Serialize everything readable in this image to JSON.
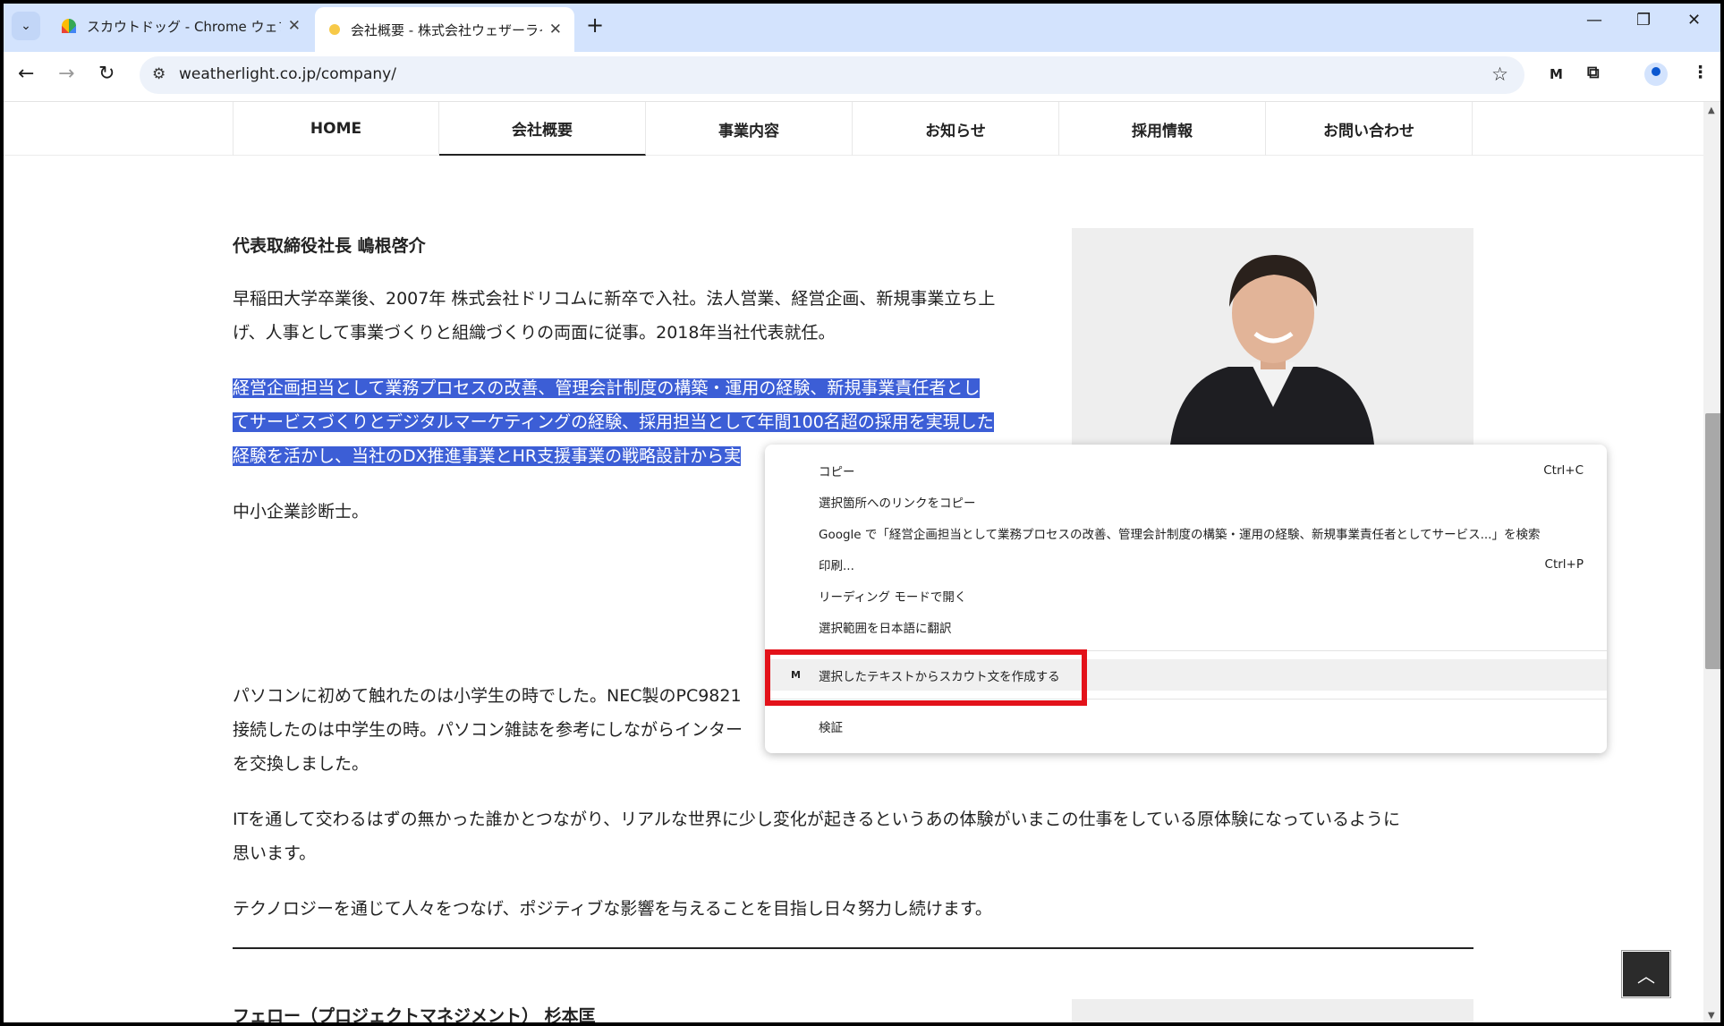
{
  "browser": {
    "tabs": [
      {
        "title": "スカウトドッグ - Chrome ウェブストア",
        "favicon": "rainbow-favicon"
      },
      {
        "title": "会社概要 - 株式会社ウェザーライト",
        "favicon": "sun-favicon"
      }
    ],
    "url": "weatherlight.co.jp/company/"
  },
  "site_nav": [
    "HOME",
    "会社概要",
    "事業内容",
    "お知らせ",
    "採用情報",
    "お問い合わせ"
  ],
  "profile": {
    "name": "代表取締役社長 嶋根啓介",
    "bio1_line1": "早稲田大学卒業後、2007年 株式会社ドリコムに新卒で入社。法人営業、経営企画、新規事業立ち上",
    "bio1_line2": "げ、人事として事業づくりと組織づくりの両面に従事。2018年当社代表就任。",
    "sel_line1": "経営企画担当として業務プロセスの改善、管理会計制度の構築・運用の経験、新規事業責任者とし",
    "sel_line2": "てサービスづくりとデジタルマーケティングの経験、採用担当として年間100名超の採用を実現した",
    "sel_line3": "経験を活かし、当社のDX推進事業とHR支援事業の戦略設計から実",
    "cert": "中小企業診断士。",
    "story_line1": "パソコンに初めて触れたのは小学生の時でした。NEC製のPC9821",
    "story_line2": "接続したのは中学生の時。パソコン雑誌を参考にしながらインター",
    "story_line3": "を交換しました。",
    "it_line1": "ITを通して交わるはずの無かった誰かとつながり、リアルな世界に少し変化が起きるというあの体験がいまこの仕事をしている原体験になっているように",
    "it_line2": "思います。",
    "closing": "テクノロジーを通じて人々をつなげ、ポジティブな影響を与えることを目指し日々努力し続けます。",
    "next_name": "フェロー（プロジェクトマネジメント） 杉本匡"
  },
  "context_menu": {
    "items": [
      {
        "label": "コピー",
        "shortcut": "Ctrl+C"
      },
      {
        "label": "選択箇所へのリンクをコピー",
        "shortcut": ""
      },
      {
        "label": "Google で「経営企画担当として業務プロセスの改善、管理会計制度の構築・運用の経験、新規事業責任者としてサービス...」を検索",
        "shortcut": ""
      },
      {
        "label": "印刷...",
        "shortcut": "Ctrl+P"
      },
      {
        "label": "リーディング モードで開く",
        "shortcut": ""
      },
      {
        "label": "選択範囲を日本語に翻訳",
        "shortcut": ""
      }
    ],
    "extension_item": "選択したテキストからスカウト文を作成する",
    "extension_icon": "M",
    "inspect": "検証"
  },
  "colors": {
    "selection": "#3c5ed6",
    "highlight_box": "#e3121a",
    "tabstrip": "#d3e3fd"
  }
}
